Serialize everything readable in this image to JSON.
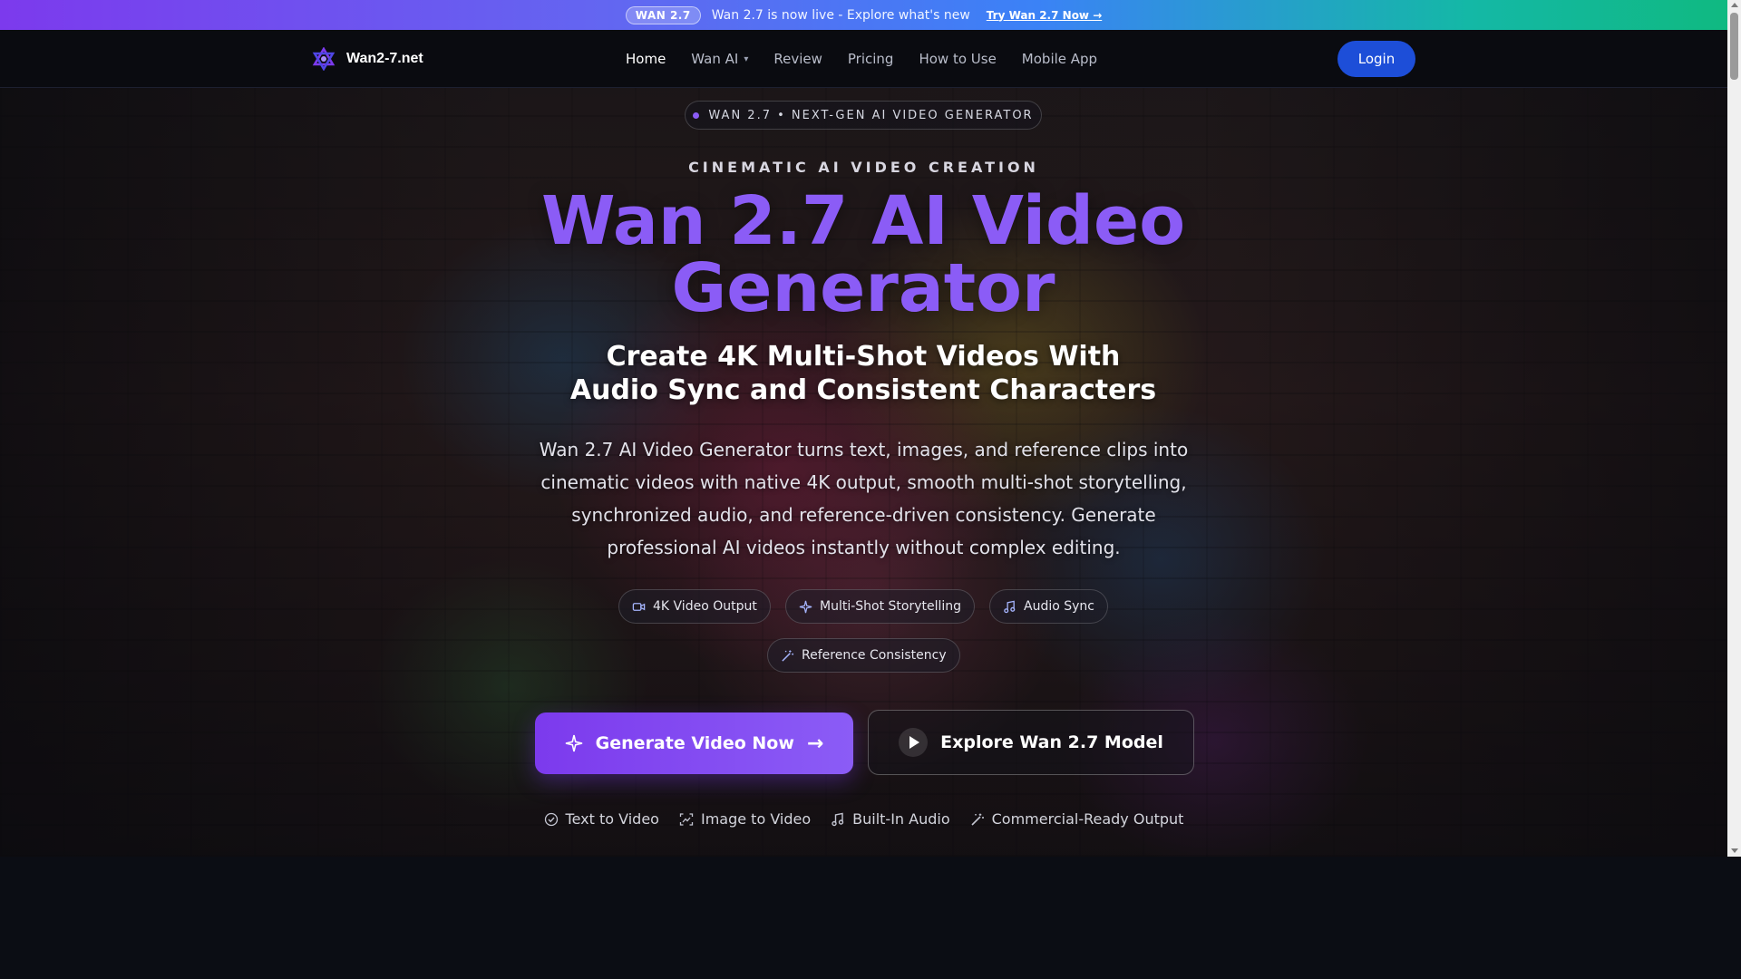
{
  "announcement": {
    "badge": "WAN 2.7",
    "text": "Wan 2.7 is now live - Explore what's new",
    "cta": "Try Wan 2.7 Now →"
  },
  "nav": {
    "logo_text": "Wan2-7.net",
    "items": [
      {
        "label": "Home",
        "active": true
      },
      {
        "label": "Wan AI",
        "dropdown": true
      },
      {
        "label": "Review"
      },
      {
        "label": "Pricing"
      },
      {
        "label": "How to Use"
      },
      {
        "label": "Mobile App"
      }
    ],
    "login": "Login"
  },
  "hero": {
    "pill": "WAN 2.7 • NEXT-GEN AI VIDEO GENERATOR",
    "eyebrow": "CINEMATIC AI VIDEO CREATION",
    "title_line1": "Wan 2.7 AI Video",
    "title_line2": "Generator",
    "subtitle_line1": "Create 4K Multi-Shot Videos With",
    "subtitle_line2": "Audio Sync and Consistent Characters",
    "description": "Wan 2.7 AI Video Generator turns text, images, and reference clips into cinematic videos with native 4K output, smooth multi-shot storytelling, synchronized audio, and reference-driven consistency. Generate professional AI videos instantly without complex editing.",
    "chips": [
      {
        "label": "4K Video Output",
        "icon": "video-camera-icon"
      },
      {
        "label": "Multi-Shot Storytelling",
        "icon": "sparkle-icon"
      },
      {
        "label": "Audio Sync",
        "icon": "music-note-icon"
      },
      {
        "label": "Reference Consistency",
        "icon": "magic-wand-icon"
      }
    ],
    "primary_button": "Generate Video Now",
    "secondary_button": "Explore Wan 2.7 Model",
    "features": [
      {
        "label": "Text to Video",
        "icon": "check-circle-icon"
      },
      {
        "label": "Image to Video",
        "icon": "image-scan-icon"
      },
      {
        "label": "Built-In Audio",
        "icon": "music-note-icon"
      },
      {
        "label": "Commercial-Ready Output",
        "icon": "magic-wand-icon"
      }
    ]
  },
  "colors": {
    "accent": "#8b5cf6",
    "login_bg": "#1d4ed8",
    "page_bg": "#0b0d14"
  }
}
